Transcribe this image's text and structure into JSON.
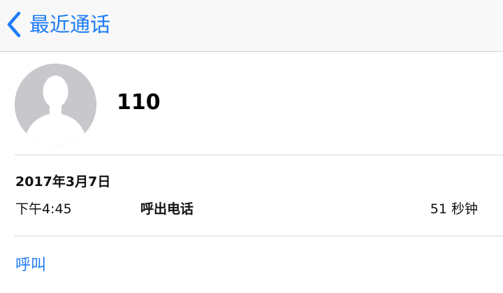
{
  "navbar": {
    "back_label": "最近通话",
    "back_icon": "chevron-left-icon",
    "accent_color": "#1e7cf6"
  },
  "contact": {
    "name": "110",
    "avatar_icon": "person-silhouette-icon"
  },
  "call": {
    "date": "2017年3月7日",
    "time": "下午4:45",
    "type": "呼出电话",
    "duration": "51 秒钟"
  },
  "actions": {
    "call_label": "呼叫"
  }
}
